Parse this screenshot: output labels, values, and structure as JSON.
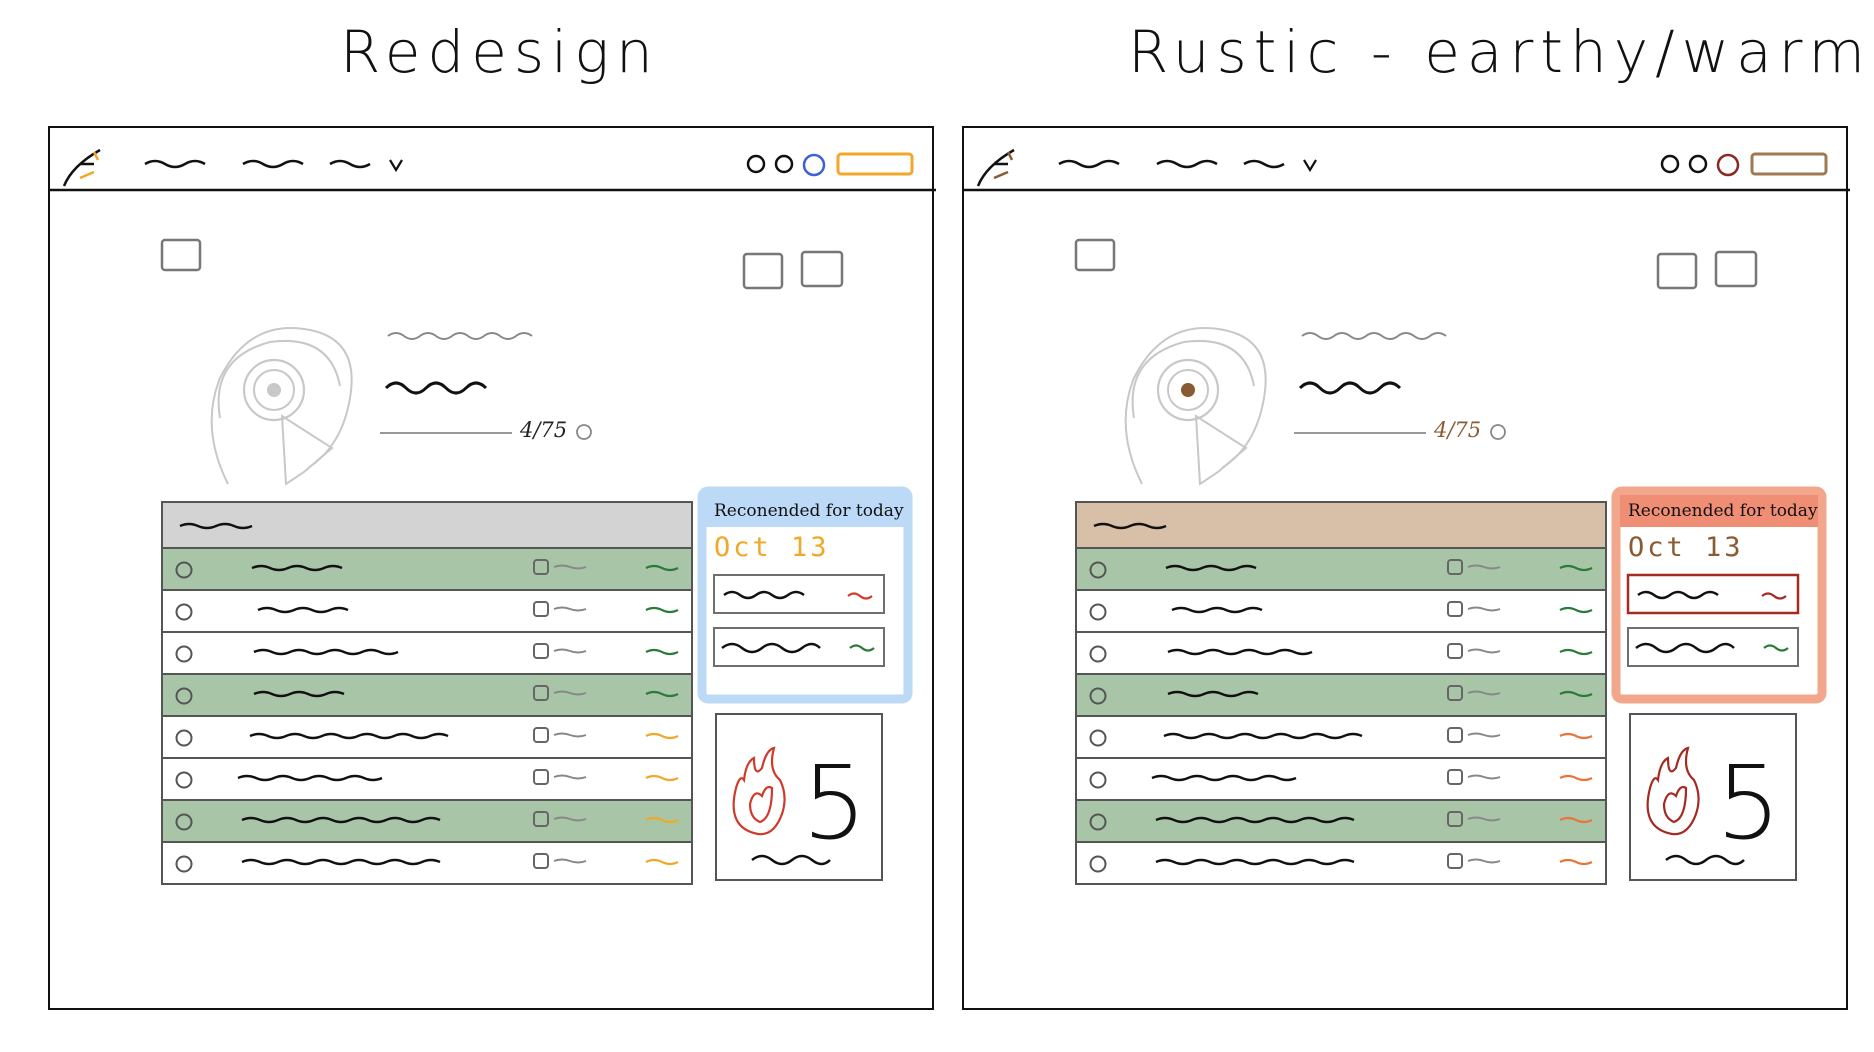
{
  "panels": [
    {
      "title": "Redesign",
      "accent": "#f0a828",
      "avatar_dot": "#c8c8c8",
      "nav_circle": "#3d62d6",
      "nav_pill": "#f2a62a",
      "table_header_bg": "#d3d3d3",
      "row_highlight": "#a8c5a8",
      "rec_glow": "#bcd9f5",
      "rec_header_bg": "#bcd9f7",
      "rec_item_border": "#6f6f6f",
      "recommended_label": "Reconended for today",
      "recommended_date": "Oct 13",
      "date_color": "#f0a828",
      "progress": "4/75",
      "progress_color": "#222222",
      "streak": "5"
    },
    {
      "title": "Rustic - earthy/warm",
      "accent": "#8a5a32",
      "avatar_dot": "#8a5a32",
      "nav_circle": "#8a2a20",
      "nav_pill": "#9c7a52",
      "table_header_bg": "#d8c0a8",
      "row_highlight": "#a8c5a8",
      "rec_glow": "#f2a78c",
      "rec_header_bg": "#ef8e74",
      "rec_item_border": "#a42a22",
      "recommended_label": "Reconended for today",
      "recommended_date": "Oct 13",
      "date_color": "#8a5a32",
      "progress": "4/75",
      "progress_color": "#8a5a32",
      "streak": "5"
    }
  ],
  "rows": [
    {
      "highlight": true,
      "status": "green"
    },
    {
      "highlight": false,
      "status": "green"
    },
    {
      "highlight": false,
      "status": "green"
    },
    {
      "highlight": true,
      "status": "green"
    },
    {
      "highlight": false,
      "status": "amber"
    },
    {
      "highlight": false,
      "status": "amber"
    },
    {
      "highlight": true,
      "status": "amber"
    },
    {
      "highlight": false,
      "status": "amber"
    }
  ],
  "status_colors": {
    "green": "#2a7a3a",
    "amber_a": "#f0a828",
    "amber_b": "#e8743a"
  }
}
